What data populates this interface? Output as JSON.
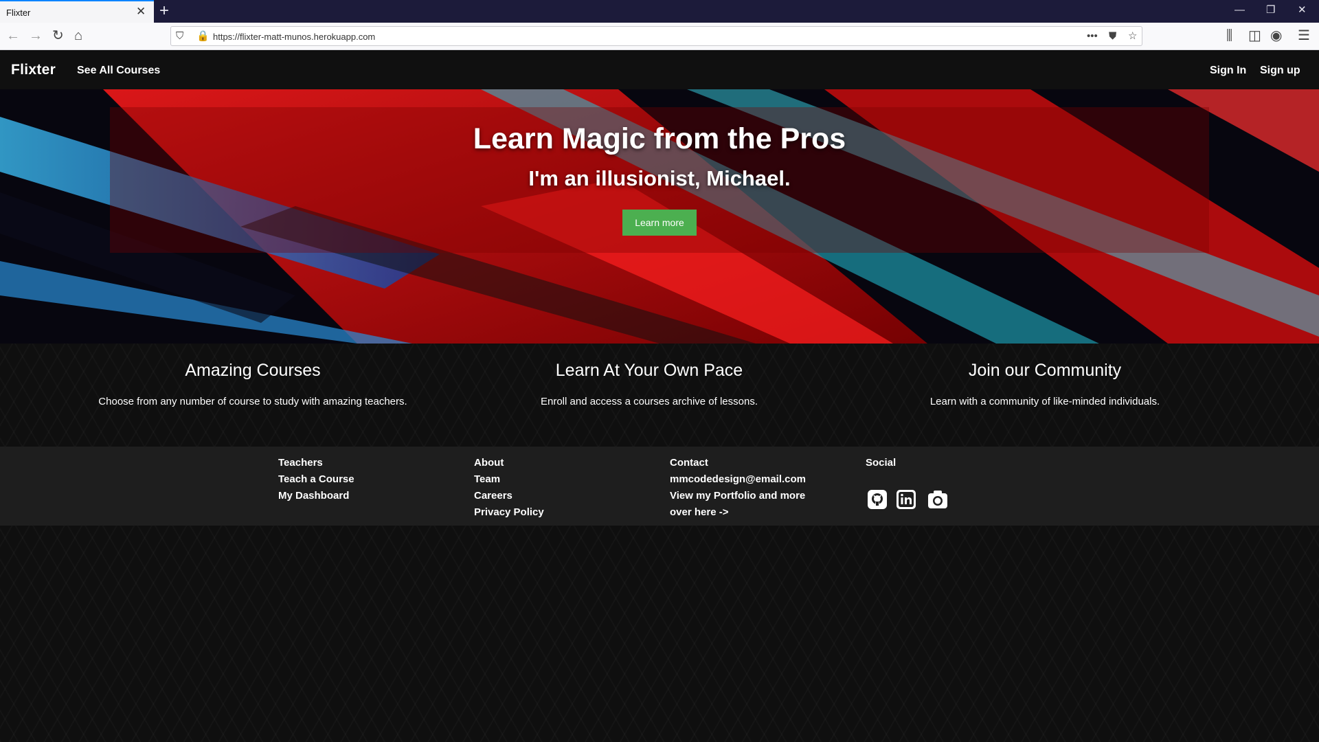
{
  "browser": {
    "tab_title": "Flixter",
    "tab_close": "✕",
    "new_tab": "+",
    "url": "https://flixter-matt-munos.herokuapp.com",
    "controls": {
      "minimize": "—",
      "restore": "❐",
      "close": "✕"
    }
  },
  "site": {
    "brand": "Flixter",
    "nav_left": "See All Courses",
    "nav_right": [
      "Sign In",
      "Sign up"
    ]
  },
  "hero": {
    "title": "Learn Magic from the Pros",
    "subtitle": "I'm an illusionist, Michael.",
    "button": "Learn more",
    "button_color": "#4caf50"
  },
  "features": [
    {
      "title": "Amazing Courses",
      "text": "Choose from any number of course to study with amazing teachers."
    },
    {
      "title": "Learn At Your Own Pace",
      "text": "Enroll and access a courses archive of lessons."
    },
    {
      "title": "Join our Community",
      "text": "Learn with a community of like-minded individuals."
    }
  ],
  "footer": {
    "col1": [
      "Teachers",
      "Teach a Course",
      "My Dashboard"
    ],
    "col2": [
      "About",
      "Team",
      "Careers",
      "Privacy Policy"
    ],
    "col3": [
      "Contact",
      "mmcodedesign@email.com",
      "View my Portfolio and more",
      "over here ->"
    ],
    "col4_title": "Social",
    "social_icons": [
      "github-icon",
      "linkedin-icon",
      "camera-icon"
    ]
  }
}
